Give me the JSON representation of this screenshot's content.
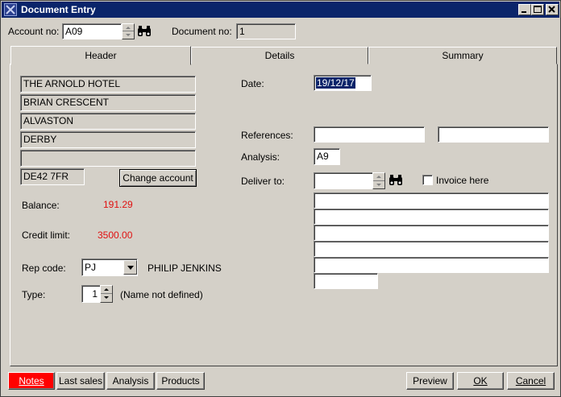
{
  "window": {
    "title": "Document Entry"
  },
  "top": {
    "account_label": "Account no:",
    "account_value": "A09",
    "document_label": "Document no:",
    "document_value": "1"
  },
  "tabs": [
    {
      "label": "Header",
      "active": true
    },
    {
      "label": "Details",
      "active": false
    },
    {
      "label": "Summary",
      "active": false
    }
  ],
  "address": {
    "lines": [
      "THE ARNOLD HOTEL",
      "BRIAN CRESCENT",
      "ALVASTON",
      "DERBY",
      ""
    ],
    "postcode": "DE42 7FR",
    "change_account_label": "Change account"
  },
  "balance": {
    "label": "Balance:",
    "value": "191.29"
  },
  "credit_limit": {
    "label": "Credit limit:",
    "value": "3500.00"
  },
  "rep": {
    "label": "Rep code:",
    "code": "PJ",
    "name": "PHILIP JENKINS"
  },
  "type": {
    "label": "Type:",
    "value": "1",
    "description": "(Name not defined)"
  },
  "date": {
    "label": "Date:",
    "value": "19/12/17"
  },
  "references": {
    "label": "References:",
    "value1": "",
    "value2": ""
  },
  "analysis": {
    "label": "Analysis:",
    "value": "A9"
  },
  "deliver": {
    "label": "Deliver to:",
    "code": "",
    "invoice_here_label": "Invoice here",
    "lines": [
      "",
      "",
      "",
      "",
      "",
      ""
    ]
  },
  "bottom": {
    "notes": "Notes",
    "last_sales": "Last sales",
    "analysis": "Analysis",
    "products": "Products",
    "preview": "Preview",
    "ok": "OK",
    "cancel": "Cancel"
  },
  "colors": {
    "titlebar": "#0a246a",
    "face": "#d4d0c8",
    "value_red": "#e01010",
    "notes_button": "#ff0000"
  }
}
